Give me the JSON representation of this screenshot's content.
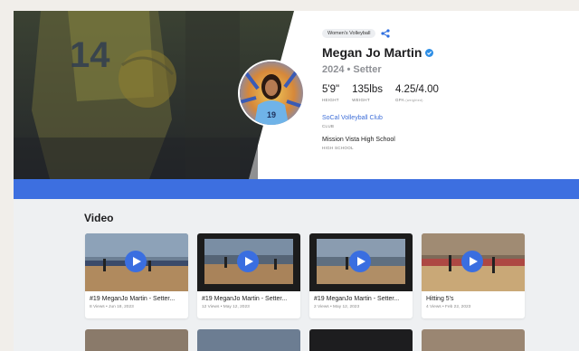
{
  "profile": {
    "sport_badge": "Women's Volleyball",
    "name": "Megan Jo Martin",
    "class_position": "2024 • Setter",
    "stats": [
      {
        "value": "5'9\"",
        "label": "HEIGHT",
        "note": ""
      },
      {
        "value": "135lbs",
        "label": "WEIGHT",
        "note": ""
      },
      {
        "value": "4.25/4.00",
        "label": "GPA",
        "note": "(weighted)"
      }
    ],
    "club": {
      "name": "SoCal Volleyball Club",
      "label": "CLUB"
    },
    "school": {
      "name": "Mission Vista High School",
      "label": "HIGH SCHOOL"
    },
    "jersey_number": "14",
    "avatar_jersey": "19"
  },
  "video_section": {
    "title": "Video",
    "videos": [
      {
        "title": "#19 MeganJo Martin - Setter...",
        "meta": "8 Views • Jun 18, 2023"
      },
      {
        "title": "#19 MeganJo Martin - Setter...",
        "meta": "12 Views • May 12, 2023"
      },
      {
        "title": "#19 MeganJo Martin - Setter...",
        "meta": "2 Views • May 12, 2023"
      },
      {
        "title": "Hitting 5's",
        "meta": "4 Views • Feb 22, 2023"
      }
    ]
  },
  "colors": {
    "accent": "#3d6fe0",
    "verified": "#2f8fe6",
    "link": "#3f6fd8"
  },
  "icons": {
    "share": "share-icon",
    "verified": "verified-check-icon",
    "play": "play-icon"
  }
}
